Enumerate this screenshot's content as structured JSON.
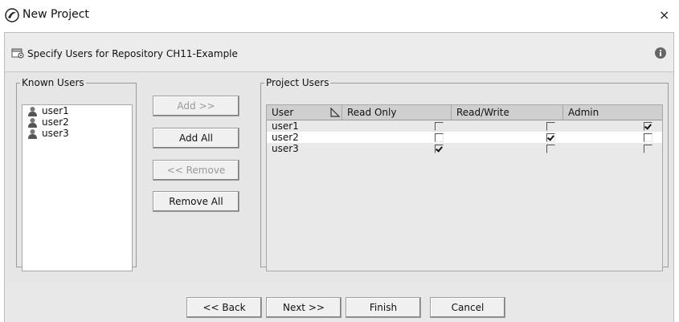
{
  "window": {
    "title": "New Project",
    "close_symbol": "×",
    "icon": "app-logo-icon"
  },
  "header": {
    "text": "Specify Users for Repository CH11-Example",
    "icon": "repository-icon",
    "info_icon": "info-icon"
  },
  "known_users": {
    "legend": "Known Users",
    "items": [
      {
        "label": "user1",
        "icon": "user-icon"
      },
      {
        "label": "user2",
        "icon": "user-icon"
      },
      {
        "label": "user3",
        "icon": "user-icon"
      }
    ]
  },
  "actions": {
    "add": "Add >>",
    "add_all": "Add All",
    "remove": "<< Remove",
    "remove_all": "Remove All"
  },
  "project_users": {
    "legend": "Project Users",
    "columns": [
      "User",
      "Read Only",
      "Read/Write",
      "Admin"
    ],
    "sort_icon": "sort-icon",
    "rows": [
      {
        "user": "user1",
        "read_only": false,
        "read_write": false,
        "admin": true,
        "selected": false
      },
      {
        "user": "user2",
        "read_only": false,
        "read_write": true,
        "admin": false,
        "selected": true
      },
      {
        "user": "user3",
        "read_only": true,
        "read_write": false,
        "admin": false,
        "selected": false
      }
    ]
  },
  "footer": {
    "back": "<< Back",
    "next": "Next >>",
    "finish": "Finish",
    "cancel": "Cancel"
  }
}
